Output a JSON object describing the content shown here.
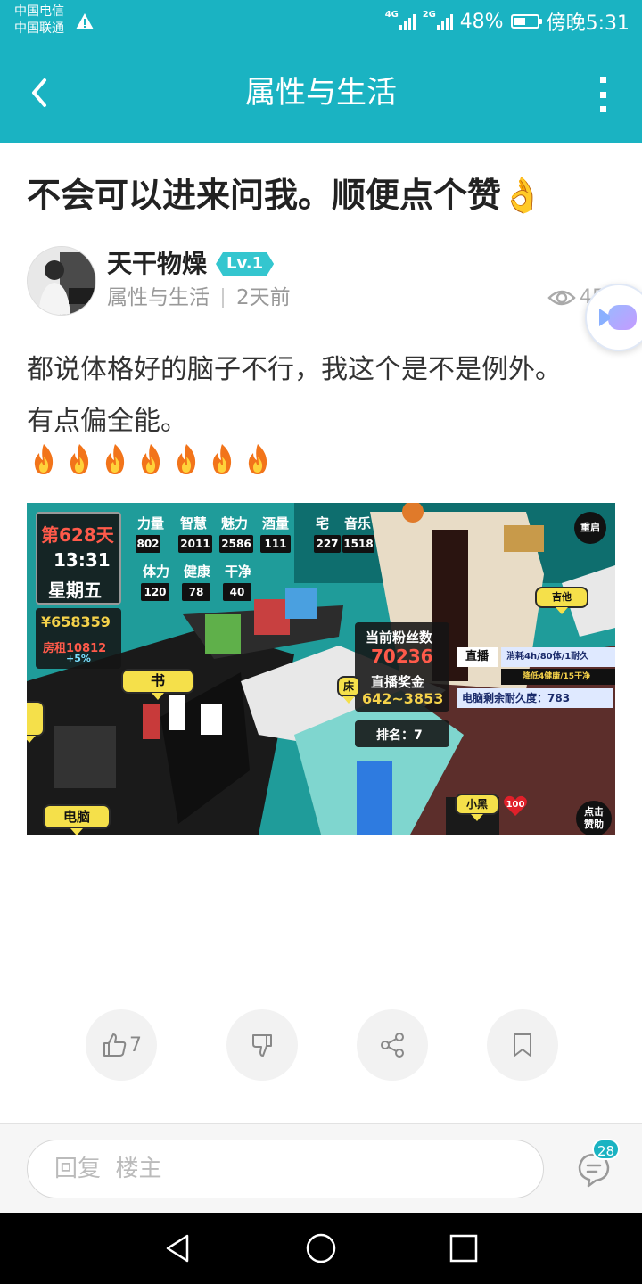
{
  "status_bar": {
    "carrier1": "中国电信",
    "carrier2": "中国联通",
    "sig1_type": "4G",
    "sig2_type": "2G",
    "battery": "48%",
    "battery_level": 0.48,
    "time": "傍晚5:31"
  },
  "app_bar": {
    "title": "属性与生活"
  },
  "post": {
    "title": "不会可以进来问我。顺便点个赞",
    "title_emoji": "👌",
    "author": "天干物燥",
    "level": "Lv.1",
    "category": "属性与生活",
    "time_ago": "2天前",
    "views": "454",
    "body_line1": "都说体格好的脑子不行，我这个是不是例外。",
    "body_line2": "有点偏全能。",
    "fire_count": 7
  },
  "game": {
    "day": "第628天",
    "clock": "13:31",
    "weekday": "星期五",
    "money": "¥658359",
    "rent": "房租10812",
    "rent_pct": "+5%",
    "stats": [
      {
        "label": "力量",
        "value": "802"
      },
      {
        "label": "智慧",
        "value": "2011"
      },
      {
        "label": "魅力",
        "value": "2586"
      },
      {
        "label": "酒量",
        "value": "111"
      },
      {
        "label": "宅",
        "value": "227"
      },
      {
        "label": "音乐",
        "value": "1518"
      },
      {
        "label": "体力",
        "value": "120"
      },
      {
        "label": "健康",
        "value": "78"
      },
      {
        "label": "干净",
        "value": "40"
      }
    ],
    "fans_label": "当前粉丝数",
    "fans": "70236",
    "bonus_label": "直播奖金",
    "bonus": "642~3853",
    "rank": "排名：7",
    "stream_btn": "直播",
    "stream_cost": "消耗4h/80体/1耐久",
    "stream_effect": "降低4健康/15干净",
    "pc_durability": "电脑剩余耐久度：783",
    "restart": "重启",
    "sponsor": "点击赞助",
    "guitar": "吉他",
    "books": "书",
    "bed": "床",
    "computer": "电脑",
    "dog": "小黑",
    "dog_hp": "100"
  },
  "actions": {
    "like_count": "7"
  },
  "reply": {
    "placeholder": "回复  楼主",
    "comment_count": "28"
  },
  "colors": {
    "accent": "#1ab3c2",
    "level_badge": "#34c6cf"
  }
}
